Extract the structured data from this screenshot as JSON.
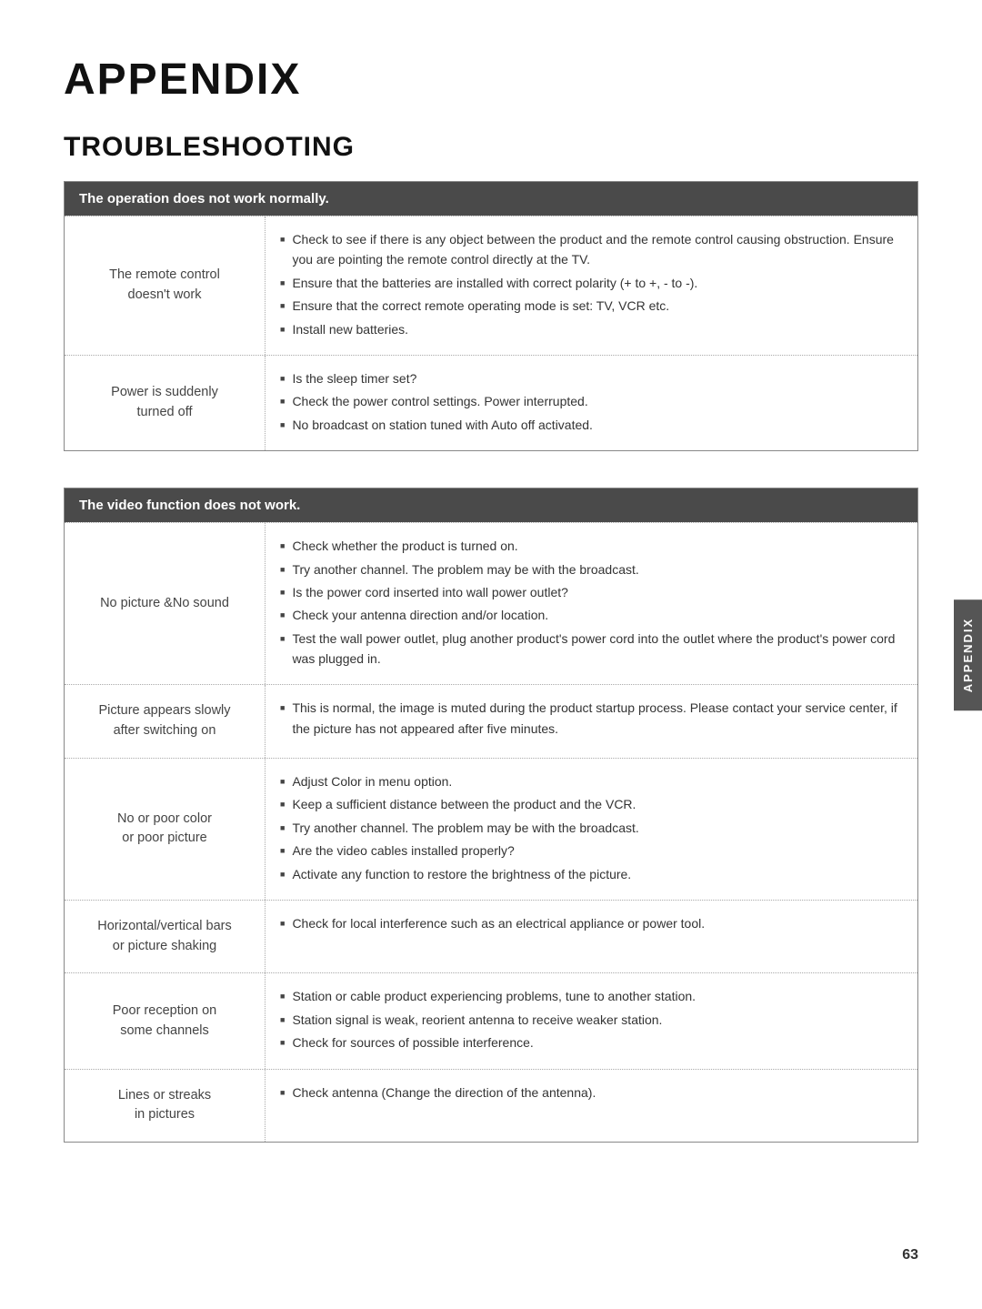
{
  "page": {
    "title": "APPENDIX",
    "section": "TROUBLESHOOTING",
    "page_number": "63",
    "side_tab": "APPENDIX"
  },
  "table1": {
    "header": "The operation does not work normally.",
    "rows": [
      {
        "label": "The remote control\ndoesn't work",
        "bullets": [
          "Check to see if there is any object between the product and the remote control causing obstruction. Ensure you are pointing the remote control directly at the TV.",
          "Ensure that the batteries are installed with correct polarity (+ to +, - to -).",
          "Ensure that the correct remote operating mode is set: TV, VCR etc.",
          "Install new batteries."
        ]
      },
      {
        "label": "Power is suddenly\nturned off",
        "bullets": [
          "Is the sleep timer set?",
          "Check the power control settings. Power interrupted.",
          "No broadcast on station tuned with Auto off activated."
        ]
      }
    ]
  },
  "table2": {
    "header": "The video function does not work.",
    "rows": [
      {
        "label": "No picture &No sound",
        "bullets": [
          "Check whether the product is turned on.",
          "Try another channel. The problem may be with the broadcast.",
          "Is the power cord inserted into wall power outlet?",
          "Check your antenna direction and/or location.",
          "Test the wall power outlet, plug another product's power cord into the outlet where the product's power cord was plugged in."
        ]
      },
      {
        "label": "Picture appears slowly\nafter switching on",
        "bullets": [
          "This is normal, the image is muted during the product startup process. Please contact your service center, if the picture has not appeared after five minutes."
        ]
      },
      {
        "label": "No or poor color\nor poor picture",
        "bullets": [
          "Adjust Color in menu option.",
          "Keep a sufficient distance between the product and the VCR.",
          "Try another channel. The problem may be with the broadcast.",
          "Are the video cables installed properly?",
          "Activate any function to restore the brightness of the picture."
        ]
      },
      {
        "label": "Horizontal/vertical bars\nor picture shaking",
        "bullets": [
          "Check for local interference such as an electrical appliance or power tool."
        ]
      },
      {
        "label": "Poor reception on\nsome channels",
        "bullets": [
          "Station or cable product experiencing problems, tune to another station.",
          "Station signal is weak, reorient antenna to receive weaker station.",
          "Check for sources of possible interference."
        ]
      },
      {
        "label": "Lines or streaks\nin pictures",
        "bullets": [
          "Check antenna (Change the direction of the antenna)."
        ]
      }
    ]
  }
}
